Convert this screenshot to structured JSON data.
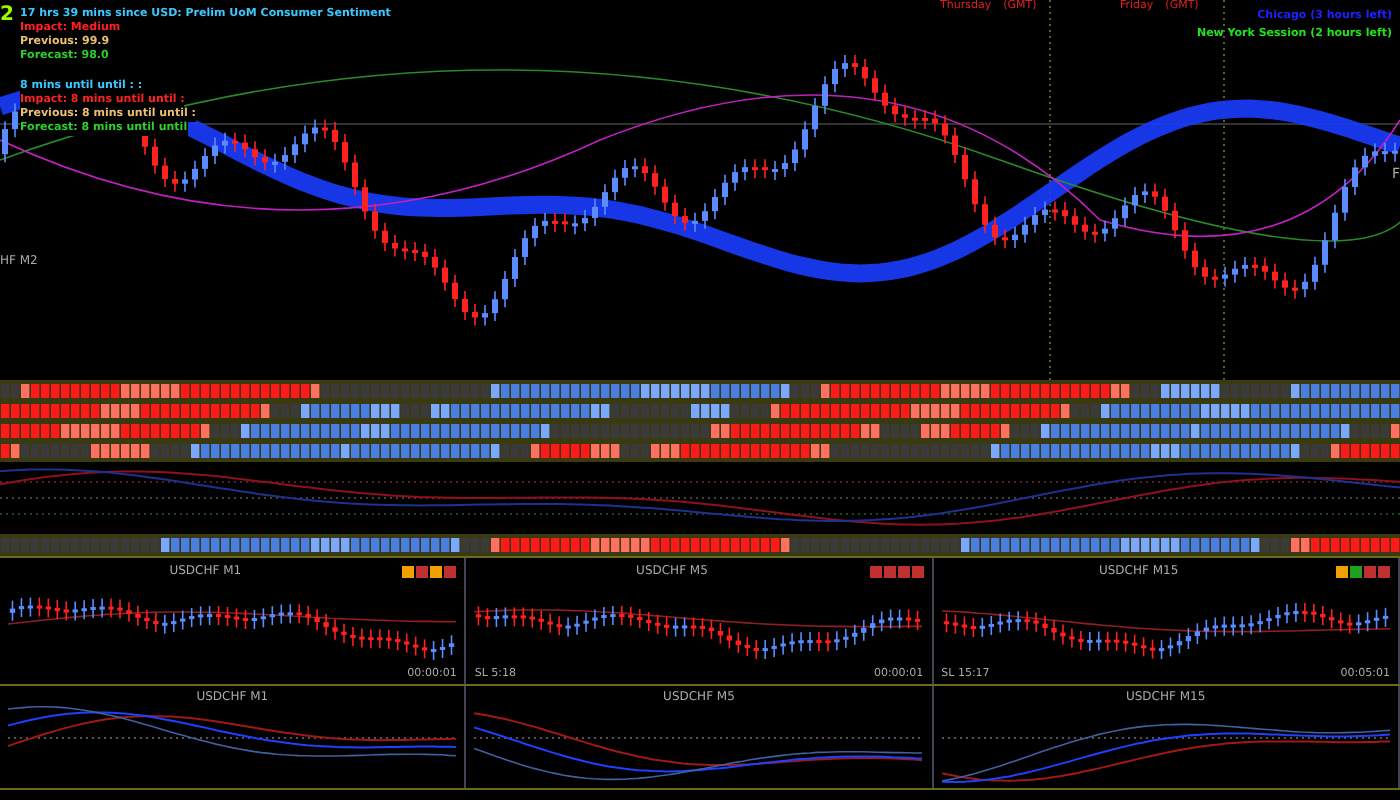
{
  "main_chart": {
    "period_badge": "2",
    "news": [
      "17 hrs 39 mins since USD: Prelim UoM Consumer Sentiment",
      "Impact: Medium",
      "Previous: 99.9",
      "Forecast: 98.0"
    ],
    "next_news": [
      "8 mins until until : :",
      "Impact: 8 mins until until :",
      "Previous: 8 mins until until :",
      "Forecast: 8 mins until until"
    ],
    "day_labels": [
      {
        "day": "Thursday",
        "zone": "(GMT)"
      },
      {
        "day": "Friday",
        "zone": "(GMT)"
      }
    ],
    "sessions": [
      {
        "label": "Chicago (3 hours left)",
        "color": "#2020ff"
      },
      {
        "label": "New York Session (2 hours left)",
        "color": "#20e020"
      }
    ],
    "side_label": "HF M2",
    "edge_label": "F"
  },
  "panels": [
    {
      "title": "USDCHF M1",
      "signals": [
        {
          "color": "#f0a000"
        },
        {
          "color": "#c03030"
        },
        {
          "color": "#f0a000"
        },
        {
          "color": "#c03030"
        }
      ],
      "timer": "00:00:01"
    },
    {
      "title": "USDCHF M5",
      "signals": [
        {
          "color": "#c03030"
        },
        {
          "color": "#c03030"
        },
        {
          "color": "#c03030"
        },
        {
          "color": "#c03030"
        }
      ],
      "stop_label": "SL 5:18",
      "timer": "00:00:01"
    },
    {
      "title": "USDCHF M15",
      "signals": [
        {
          "color": "#f0a000"
        },
        {
          "color": "#20a020"
        },
        {
          "color": "#c03030"
        },
        {
          "color": "#c03030"
        }
      ],
      "stop_label": "SL 15:17",
      "timer": "00:05:01"
    }
  ],
  "oscillators": [
    {
      "title": "USDCHF M1"
    },
    {
      "title": "USDCHF M5"
    },
    {
      "title": "USDCHF M15"
    }
  ]
}
